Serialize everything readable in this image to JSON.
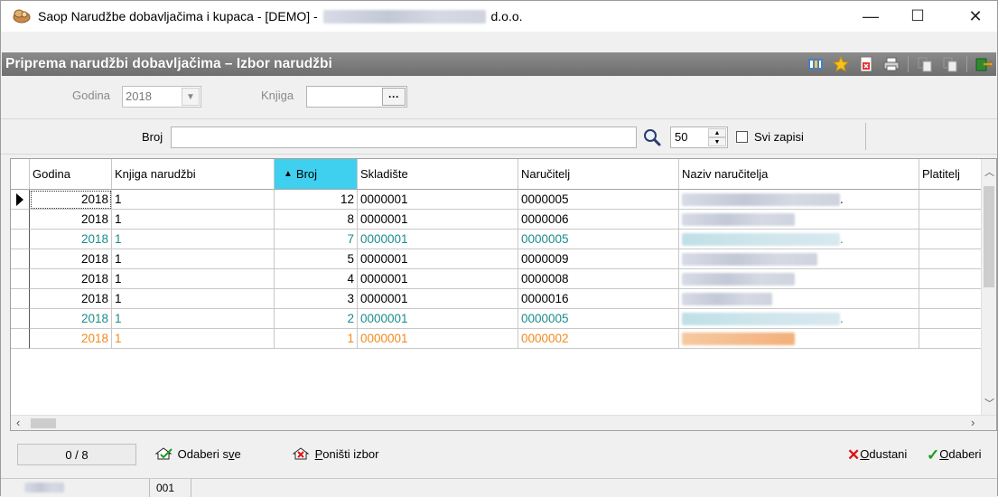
{
  "window": {
    "title_prefix": "Saop Narudžbe dobavljačima i kupaca -  [DEMO] -",
    "title_suffix": "d.o.o.",
    "minimize": "—",
    "maximize": "☐",
    "close": "✕"
  },
  "header": {
    "title": "Priprema narudžbi dobavljačima – Izbor narudžbi"
  },
  "filters": {
    "godina_label": "Godina",
    "godina_value": "2018",
    "knjiga_label": "Knjiga",
    "knjiga_value": "",
    "browse": "···"
  },
  "search": {
    "broj_label": "Broj",
    "broj_value": "",
    "count_value": "50",
    "svi_zapisi_label": "Svi zapisi",
    "svi_zapisi_checked": false
  },
  "grid": {
    "columns": [
      "Godina",
      "Knjiga narudžbi",
      "Broj",
      "Skladište",
      "Naručitelj",
      "Naziv naručitelja",
      "Platitelj"
    ],
    "sorted_column": "Broj",
    "rows": [
      {
        "godina": "2018",
        "knjiga": "1",
        "broj": "12",
        "skladiste": "0000001",
        "narucitelj": "0000005",
        "naziv_suffix": ".",
        "color": "#000000",
        "current": true
      },
      {
        "godina": "2018",
        "knjiga": "1",
        "broj": "8",
        "skladiste": "0000001",
        "narucitelj": "0000006",
        "naziv_suffix": "",
        "color": "#000000",
        "current": false
      },
      {
        "godina": "2018",
        "knjiga": "1",
        "broj": "7",
        "skladiste": "0000001",
        "narucitelj": "0000005",
        "naziv_suffix": ".",
        "color": "#1a8c8c",
        "current": false
      },
      {
        "godina": "2018",
        "knjiga": "1",
        "broj": "5",
        "skladiste": "0000001",
        "narucitelj": "0000009",
        "naziv_suffix": "",
        "color": "#000000",
        "current": false
      },
      {
        "godina": "2018",
        "knjiga": "1",
        "broj": "4",
        "skladiste": "0000001",
        "narucitelj": "0000008",
        "naziv_suffix": "",
        "color": "#000000",
        "current": false
      },
      {
        "godina": "2018",
        "knjiga": "1",
        "broj": "3",
        "skladiste": "0000001",
        "narucitelj": "0000016",
        "naziv_suffix": "",
        "color": "#000000",
        "current": false
      },
      {
        "godina": "2018",
        "knjiga": "1",
        "broj": "2",
        "skladiste": "0000001",
        "narucitelj": "0000005",
        "naziv_suffix": ".",
        "color": "#1a8c8c",
        "current": false
      },
      {
        "godina": "2018",
        "knjiga": "1",
        "broj": "1",
        "skladiste": "0000001",
        "narucitelj": "0000002",
        "naziv_suffix": "",
        "color": "#f08a1c",
        "current": false
      }
    ]
  },
  "status": {
    "counter": "0 / 8",
    "select_all_pre": "Odaberi s",
    "select_all_u": "v",
    "select_all_post": "e",
    "clear_u": "P",
    "clear_post": "oništi izbor",
    "cancel_u": "O",
    "cancel_post": "dustani",
    "ok_u": "O",
    "ok_post": "daberi"
  },
  "footer": {
    "code": "001"
  },
  "colors": {
    "header_bar": "#7a7a7a",
    "sorted_header": "#3fd0f0",
    "teal_row": "#1a8c8c",
    "orange_row": "#f08a1c",
    "cancel_x": "#e01010",
    "ok_check": "#1c9a1c"
  }
}
